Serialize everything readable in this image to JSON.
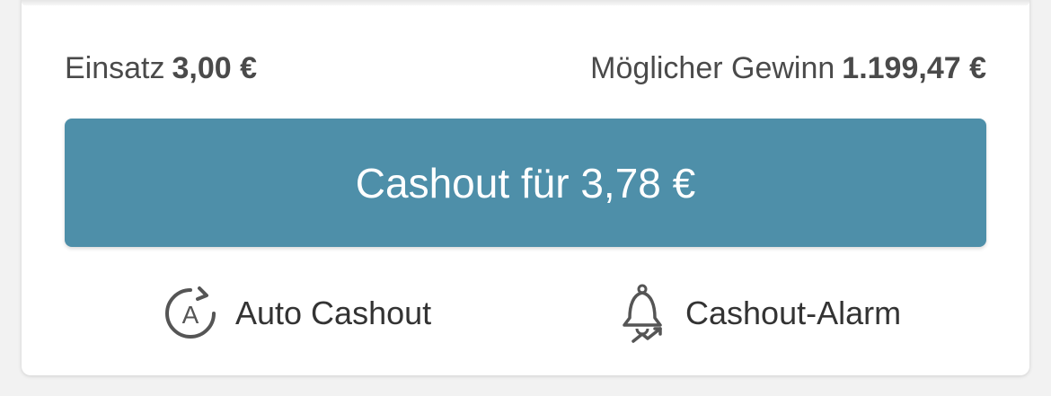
{
  "stake": {
    "label": "Einsatz",
    "value": "3,00 €"
  },
  "potential_win": {
    "label": "Möglicher Gewinn",
    "value": "1.199,47 €"
  },
  "cashout_button": {
    "label": "Cashout für 3,78 €"
  },
  "actions": {
    "auto_cashout": {
      "label": "Auto Cashout",
      "icon": "auto-cashout-icon"
    },
    "cashout_alarm": {
      "label": "Cashout-Alarm",
      "icon": "bell-trend-icon"
    }
  },
  "colors": {
    "accent": "#4e8fa9",
    "text": "#4a4a4a",
    "icon": "#555555"
  }
}
